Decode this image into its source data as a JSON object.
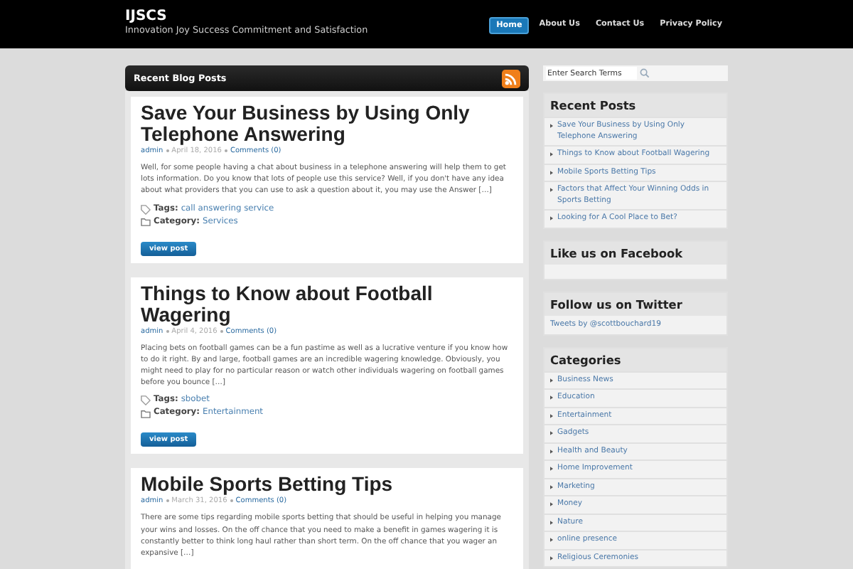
{
  "site": {
    "title": "IJSCS",
    "tagline": "Innovation Joy Success Commitment and Satisfaction"
  },
  "nav": [
    {
      "label": "Home",
      "selected": true
    },
    {
      "label": "About Us",
      "selected": false
    },
    {
      "label": "Contact Us",
      "selected": false
    },
    {
      "label": "Privacy Policy",
      "selected": false
    }
  ],
  "main": {
    "heading": "Recent Blog Posts",
    "posts": [
      {
        "title": "Save Your Business by Using Only Telephone Answering",
        "author": "admin",
        "date": "April 18, 2016",
        "comments": "Comments (0)",
        "excerpt": "Well, for some people having a chat about business in a telephone answering will help them to get lots information. Do you know that lots of people use this service? Well, if you don't have any idea about what providers that you can use to ask a question about it, you may use the Answer […]",
        "tags_label": "Tags:",
        "tags": "call answering service",
        "category_label": "Category:",
        "category": "Services",
        "button": "view post"
      },
      {
        "title": "Things to Know about Football Wagering",
        "author": "admin",
        "date": "April 4, 2016",
        "comments": "Comments (0)",
        "excerpt": "Placing bets on football games can be a fun pastime as well as a lucrative venture if you know how to do it right. By and large, football games are an incredible wagering knowledge. Obviously, you might need to play for no particular reason or watch other individuals wagering on football games before you bounce […]",
        "tags_label": "Tags:",
        "tags": "sbobet",
        "category_label": "Category:",
        "category": "Entertainment",
        "button": "view post"
      },
      {
        "title": "Mobile Sports Betting Tips",
        "author": "admin",
        "date": "March 31, 2016",
        "comments": "Comments (0)",
        "excerpt": "There are some tips regarding mobile sports betting that should be useful in helping you manage your wins and losses. On the off chance that you need to make a benefit in games wagering it is constantly better to think long haul rather than short term. On the off chance that you wager an expansive […]"
      }
    ]
  },
  "sidebar": {
    "search": {
      "placeholder": "Enter Search Terms"
    },
    "widgets": [
      {
        "title": "Recent Posts",
        "items": [
          "Save Your Business by Using Only Telephone Answering",
          "Things to Know about Football Wagering",
          "Mobile Sports Betting Tips",
          "Factors that Affect Your Winning Odds in Sports Betting",
          "Looking for A Cool Place to Bet?"
        ]
      },
      {
        "title": "Like us on Facebook"
      },
      {
        "title": "Follow us on Twitter",
        "link": "Tweets by @scottbouchard19"
      },
      {
        "title": "Categories",
        "items": [
          "Business News",
          "Education",
          "Entertainment",
          "Gadgets",
          "Health and Beauty",
          "Home Improvement",
          "Marketing",
          "Money",
          "Nature",
          "online presence",
          "Religious Ceremonies"
        ]
      }
    ]
  }
}
